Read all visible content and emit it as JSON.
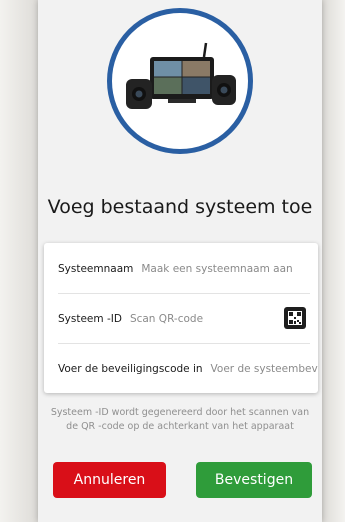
{
  "dialog": {
    "title": "Voeg bestaand systeem toe",
    "hero_image": "camera-system-illustration"
  },
  "form": {
    "system_name": {
      "label": "Systeemnaam",
      "placeholder": "Maak een systeemnaam aan"
    },
    "system_id": {
      "label": "Systeem -ID",
      "placeholder": "Scan QR-code",
      "icon": "qr-code-icon"
    },
    "security_code": {
      "label": "Voer de beveiligingscode in",
      "placeholder": "Voer de systeembeveil"
    }
  },
  "hint": "Systeem -ID wordt gegenereerd door het scannen van de QR -code op de achterkant van het apparaat",
  "buttons": {
    "cancel": "Annuleren",
    "confirm": "Bevestigen"
  },
  "colors": {
    "cancel": "#d90f18",
    "confirm": "#2f9c3a",
    "hero_ring": "#2a5fa3"
  }
}
